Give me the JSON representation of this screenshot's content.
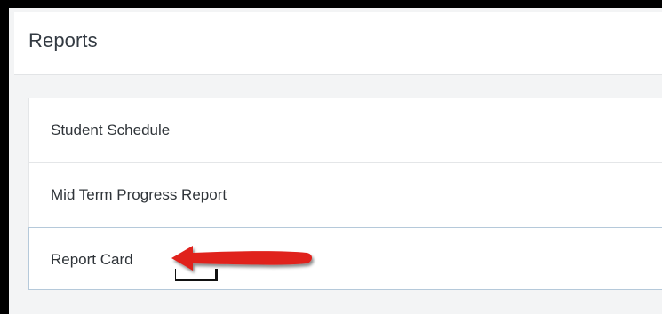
{
  "header": {
    "title": "Reports"
  },
  "reports": {
    "items": [
      {
        "label": "Student Schedule"
      },
      {
        "label": "Mid Term Progress Report"
      },
      {
        "label": "Report Card"
      }
    ]
  },
  "annotation": {
    "arrow_color": "#e0201c"
  }
}
